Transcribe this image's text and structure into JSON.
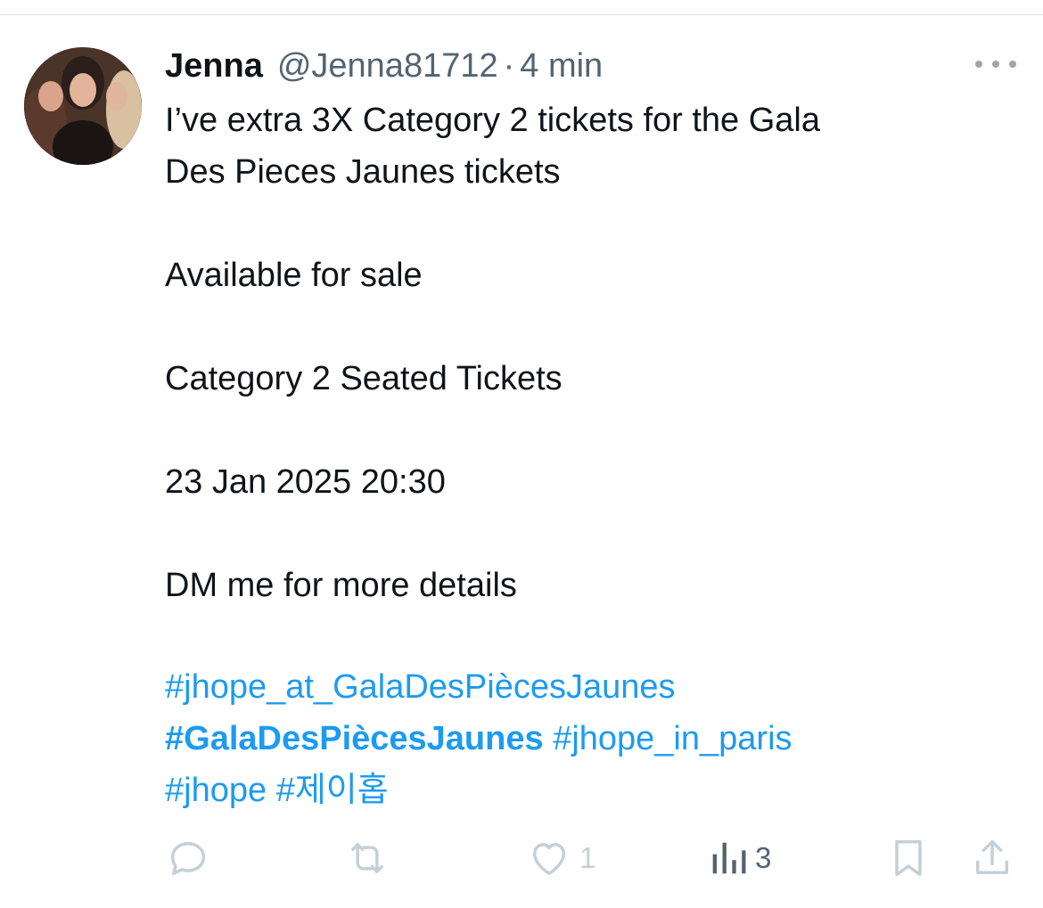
{
  "tweet": {
    "display_name": "Jenna",
    "handle": "@Jenna81712",
    "separator": "·",
    "time": "4 min",
    "lines": [
      "I’ve extra  3X Category 2 tickets for the Gala",
      "Des Pieces Jaunes tickets",
      "Available for sale",
      "Category 2 Seated Tickets",
      "23 Jan 2025 20:30",
      "DM me for more details"
    ],
    "hashtags": {
      "line1": "#jhope_at_GalaDesPiècesJaunes",
      "line2_bold": "#GalaDesPiècesJaunes",
      "line2_rest": "#jhope_in_paris",
      "line3a": "#jhope",
      "line3b": "#제이홉"
    }
  },
  "actions": {
    "reply": {
      "icon": "reply-icon"
    },
    "retweet": {
      "icon": "retweet-icon"
    },
    "like": {
      "icon": "heart-icon",
      "count": "1"
    },
    "views": {
      "icon": "views-icon",
      "count": "3"
    },
    "bookmark": {
      "icon": "bookmark-icon"
    },
    "share": {
      "icon": "share-icon"
    }
  },
  "colors": {
    "text": "#0f1419",
    "secondary": "#536471",
    "link": "#1d9bf0",
    "faint_icon": "#c4d0d8"
  }
}
